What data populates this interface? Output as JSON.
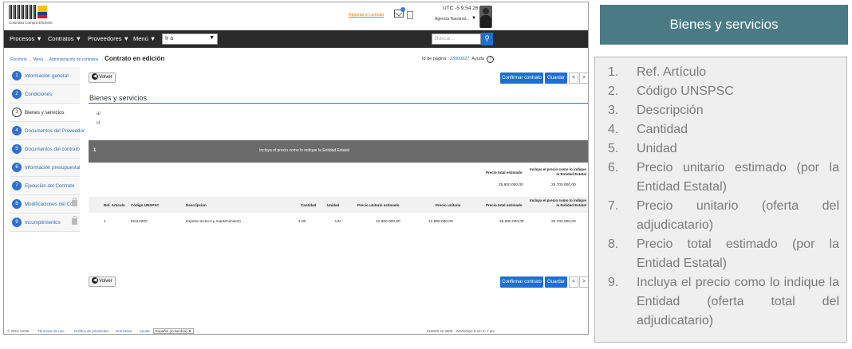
{
  "screenshot": {
    "logo_text": "Colombia Compra Eficiente",
    "report_link": "Reportar el contrato",
    "clock": "UTC -5 9:54:26",
    "agency": "Agencia Nacional...",
    "nav": {
      "items": [
        "Procesos ▼",
        "Contratos ▼",
        "Proveedores ▼",
        "Menú ▼"
      ],
      "goto_value": "Ir a",
      "search_placeholder": "Buscar..."
    },
    "breadcrumb": {
      "path": "Escritorio → Menú → Administración de contratos →",
      "current": "Contrato en edición"
    },
    "page_id_label": "Id de página :",
    "page_id_value": "23000027",
    "help_label": "Ayuda",
    "side_menu": [
      {
        "num": "1",
        "label": "Información general",
        "active": false,
        "locked": false
      },
      {
        "num": "2",
        "label": "Condiciones",
        "active": false,
        "locked": false
      },
      {
        "num": "3",
        "label": "Bienes y servicios",
        "active": true,
        "locked": false
      },
      {
        "num": "4",
        "label": "Documentos del Proveedor",
        "active": false,
        "locked": false
      },
      {
        "num": "5",
        "label": "Documentos del contrato",
        "active": false,
        "locked": false
      },
      {
        "num": "6",
        "label": "Información presupuestal",
        "active": false,
        "locked": false
      },
      {
        "num": "7",
        "label": "Ejecución del Contrato",
        "active": false,
        "locked": false
      },
      {
        "num": "8",
        "label": "Modificaciones del Co...",
        "active": false,
        "locked": true
      },
      {
        "num": "9",
        "label": "Incumplimientos",
        "active": false,
        "locked": true
      }
    ],
    "buttons": {
      "back": "Volver",
      "confirm": "Confirmar contrato",
      "save": "Guardar",
      "prev": "<",
      "next": ">"
    },
    "section_title": "Bienes y servicios",
    "glyphs": [
      "al",
      "cl"
    ],
    "band": {
      "num": "1",
      "text": "Incluya el precio como lo indique la Entidad Estatal"
    },
    "summary": {
      "h_total_est": "Precio total estimado",
      "h_incluya": "Incluya el precio como lo indique la Entidad Estatal",
      "v_total_est": "25.800.000,00",
      "v_incluya": "25.700.000,00"
    },
    "table": {
      "headers": [
        "Ref. Artículo",
        "Código UNSPSC",
        "Descripción",
        "Cantidad",
        "Unidad",
        "Precio unitario estimado",
        "Precio unitario",
        "Precio total estimado",
        "Incluya el precio como lo indique la Entidad Estatal"
      ],
      "row": [
        "1",
        "81112200",
        "soporte tecnico y mantenimiento",
        "2.00",
        "UN",
        "12.900.000,00",
        "12.850.000,00",
        "25.800.000,00",
        "25.700.000,00"
      ]
    },
    "footer": {
      "copyright": "© 2014 Vortal.",
      "links": [
        "Términos de uso",
        "Política de privacidad",
        "Normativa",
        "Ayuda"
      ],
      "language": "Español (Colombia) ▼",
      "right": "018000 52 0808 · Weekdays 8 am to 7 pm"
    }
  },
  "right_panel": {
    "title": "Bienes y servicios",
    "items": [
      {
        "num": "1.",
        "text": "Ref. Artículo"
      },
      {
        "num": "2.",
        "text": "Código UNSPSC"
      },
      {
        "num": "3.",
        "text": "Descripción"
      },
      {
        "num": "4.",
        "text": "Cantidad"
      },
      {
        "num": "5.",
        "text": "Unidad"
      },
      {
        "num": "6.",
        "text": "Precio unitario estimado (por la Entidad Estatal)"
      },
      {
        "num": "7.",
        "text": "Precio unitario (oferta del adjudicatario)"
      },
      {
        "num": "8.",
        "text": "Precio total estimado (por la Entidad Estatal)"
      },
      {
        "num": "9.",
        "text": "Incluya el precio como lo indique la Entidad (oferta total del adjudicatario)"
      }
    ]
  }
}
